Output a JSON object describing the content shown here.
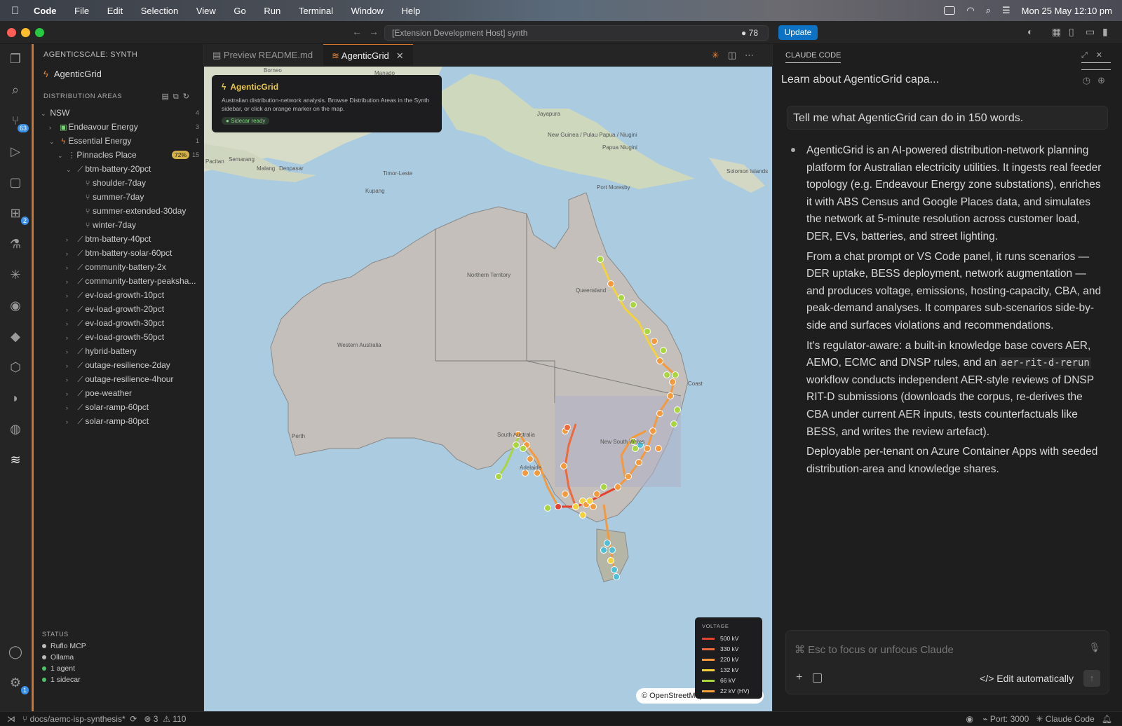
{
  "menubar": {
    "app": "Code",
    "items": [
      "File",
      "Edit",
      "Selection",
      "View",
      "Go",
      "Run",
      "Terminal",
      "Window",
      "Help"
    ],
    "datetime": "Mon 25 May  12:10 pm"
  },
  "titlebar": {
    "command_center": "[Extension Development Host] synth",
    "count": "78",
    "update_label": "Update"
  },
  "activity_badges": {
    "source_control": "63",
    "extensions": "2",
    "settings": "1"
  },
  "sidebar": {
    "header": "AGENTICSCALE: SYNTH",
    "app_name": "AgenticGrid",
    "section": "DISTRIBUTION AREAS",
    "tree": [
      {
        "label": "NSW",
        "count": "4"
      },
      {
        "label": "Endeavour Energy",
        "count": "3"
      },
      {
        "label": "Essential Energy",
        "count": "1"
      },
      {
        "label": "Pinnacles Place",
        "pct": "72%",
        "count": "15"
      },
      {
        "label": "btm-battery-20pct"
      },
      {
        "label": "shoulder-7day"
      },
      {
        "label": "summer-7day"
      },
      {
        "label": "summer-extended-30day"
      },
      {
        "label": "winter-7day"
      },
      {
        "label": "btm-battery-40pct"
      },
      {
        "label": "btm-battery-solar-60pct"
      },
      {
        "label": "community-battery-2x"
      },
      {
        "label": "community-battery-peaksha..."
      },
      {
        "label": "ev-load-growth-10pct"
      },
      {
        "label": "ev-load-growth-20pct"
      },
      {
        "label": "ev-load-growth-30pct"
      },
      {
        "label": "ev-load-growth-50pct"
      },
      {
        "label": "hybrid-battery"
      },
      {
        "label": "outage-resilience-2day"
      },
      {
        "label": "outage-resilience-4hour"
      },
      {
        "label": "poe-weather"
      },
      {
        "label": "solar-ramp-60pct"
      },
      {
        "label": "solar-ramp-80pct"
      }
    ],
    "status_title": "STATUS",
    "status": [
      {
        "label": "Ruflo MCP",
        "color": "#bbbbbb"
      },
      {
        "label": "Ollama",
        "color": "#bbbbbb"
      },
      {
        "label": "1 agent",
        "color": "#4fc36a"
      },
      {
        "label": "1 sidecar",
        "color": "#4fc36a"
      }
    ]
  },
  "tabs": [
    {
      "label": "Preview README.md"
    },
    {
      "label": "AgenticGrid"
    }
  ],
  "map": {
    "popup_title": "AgenticGrid",
    "popup_desc": "Australian distribution-network analysis. Browse Distribution Areas in the Synth sidebar, or click an orange marker on the map.",
    "popup_status": "Sidecar ready",
    "legend_title": "VOLTAGE",
    "legend": [
      {
        "label": "500 kV",
        "color": "#e2432f"
      },
      {
        "label": "330 kV",
        "color": "#ef6a3a"
      },
      {
        "label": "220 kV",
        "color": "#f59a3c"
      },
      {
        "label": "132 kV",
        "color": "#f3d23c"
      },
      {
        "label": "66 kV",
        "color": "#a9d63f"
      },
      {
        "label": "22 kV (HV)",
        "color": "#f5a23c"
      }
    ],
    "attribution": "© OpenStreetMap",
    "places": {
      "borneo": "Borneo",
      "manado": "Manado",
      "jayapura": "Jayapura",
      "png": "New Guinea / Pulau Papua / Niugini",
      "papua": "Papua Niugini",
      "portmoresby": "Port Moresby",
      "solomon": "Solomon Islands",
      "timorleste": "Timor-Leste",
      "kupang": "Kupang",
      "semarang": "Semarang",
      "malang": "Malang",
      "denpasar": "Denpasar",
      "nt": "Northern Territory",
      "qld": "Queensland",
      "wa": "Western Australia",
      "sa": "South Australia",
      "nsw": "New South Wales",
      "perth": "Perth",
      "adelaide": "Adelaide",
      "goldcoast": "Coast",
      "pacitan": "Pacitan"
    }
  },
  "chat": {
    "panel_title": "CLAUDE CODE",
    "session_title": "Learn about AgenticGrid capa...",
    "prompt": "Tell me what AgenticGrid can do in 150 words.",
    "p1": "AgenticGrid is an AI-powered distribution-network planning platform for Australian electricity utilities. It ingests real feeder topology (e.g. Endeavour Energy zone substations), enriches it with ABS Census and Google Places data, and simulates the network at 5-minute resolution across customer load, DER, EVs, batteries, and street lighting.",
    "p2": "From a chat prompt or VS Code panel, it runs scenarios — DER uptake, BESS deployment, network augmentation — and produces voltage, emissions, hosting-capacity, CBA, and peak-demand analyses. It compares sub-scenarios side-by-side and surfaces violations and recommendations.",
    "p3_a": "It's regulator-aware: a built-in knowledge base covers AER, AEMO, ECMC and DNSP rules, and an ",
    "p3_code": "aer-rit-d-rerun",
    "p3_b": " workflow conducts independent AER-style reviews of DNSP RIT-D submissions (downloads the corpus, re-derives the CBA under current AER inputs, tests counterfactuals like BESS, and writes the review artefact).",
    "p4": "Deployable per-tenant on Azure Container Apps with seeded distribution-area and knowledge shares.",
    "input_placeholder": "⌘ Esc to focus or unfocus Claude",
    "edit_mode": "Edit automatically"
  },
  "statusbar": {
    "branch": "docs/aemc-isp-synthesis*",
    "errors": "3",
    "warnings": "110",
    "port": "Port: 3000",
    "claude": "Claude Code"
  }
}
